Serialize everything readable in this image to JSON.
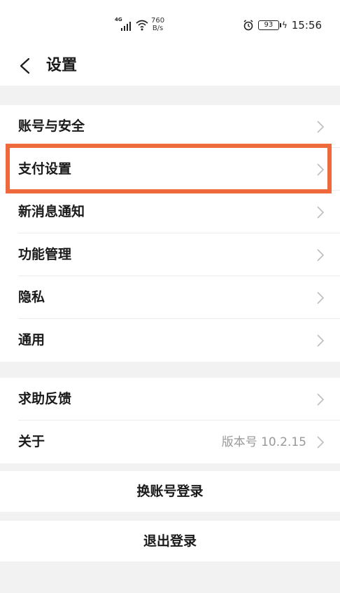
{
  "status_bar": {
    "network_type": "4G",
    "speed_value": "760",
    "speed_unit": "B/s",
    "battery": "93",
    "time": "15:56",
    "icons": [
      "signal-icon",
      "wifi-icon",
      "alarm-icon",
      "battery-icon",
      "charging-icon"
    ]
  },
  "header": {
    "back_icon": "chevron-left-icon",
    "title": "设置"
  },
  "groups": [
    {
      "items": [
        {
          "label": "账号与安全"
        },
        {
          "label": "支付设置"
        },
        {
          "label": "新消息通知"
        },
        {
          "label": "功能管理"
        },
        {
          "label": "隐私"
        },
        {
          "label": "通用"
        }
      ]
    },
    {
      "items": [
        {
          "label": "求助反馈"
        },
        {
          "label": "关于",
          "value": "版本号 10.2.15"
        }
      ]
    }
  ],
  "actions": {
    "switch_account": "换账号登录",
    "logout": "退出登录"
  },
  "colors": {
    "highlight": "#ee6a3c",
    "background": "#f2f2f2"
  }
}
